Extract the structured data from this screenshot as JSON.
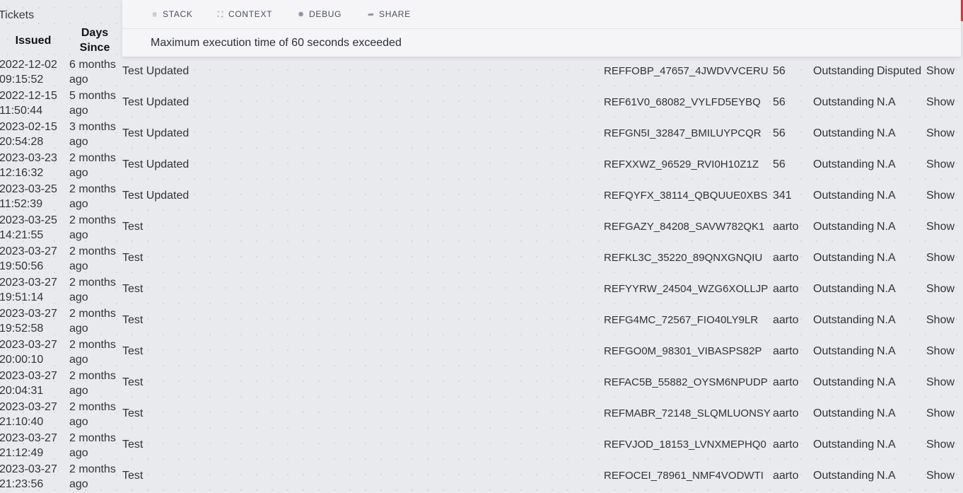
{
  "page": {
    "title": "Tickets"
  },
  "table": {
    "headers": {
      "issued": "Issued",
      "days_since_line1": "Days",
      "days_since_line2": "Since"
    },
    "rows": [
      {
        "issued_date": "2022-12-02",
        "issued_time": "09:15:52",
        "since_1": "6 months",
        "since_2": "ago",
        "title": "Test Updated",
        "reference": "REFFOBP_47657_4JWDVVCERU",
        "amount": "56",
        "status": "Outstanding",
        "dispute": "Disputed",
        "action": "Show"
      },
      {
        "issued_date": "2022-12-15",
        "issued_time": "11:50:44",
        "since_1": "5 months",
        "since_2": "ago",
        "title": "Test Updated",
        "reference": "REF61V0_68082_VYLFD5EYBQ",
        "amount": "56",
        "status": "Outstanding",
        "dispute": "N.A",
        "action": "Show"
      },
      {
        "issued_date": "2023-02-15",
        "issued_time": "20:54:28",
        "since_1": "3 months",
        "since_2": "ago",
        "title": "Test Updated",
        "reference": "REFGN5I_32847_BMILUYPCQR",
        "amount": "56",
        "status": "Outstanding",
        "dispute": "N.A",
        "action": "Show"
      },
      {
        "issued_date": "2023-03-23",
        "issued_time": "12:16:32",
        "since_1": "2 months",
        "since_2": "ago",
        "title": "Test Updated",
        "reference": "REFXXWZ_96529_RVI0H10Z1Z",
        "amount": "56",
        "status": "Outstanding",
        "dispute": "N.A",
        "action": "Show"
      },
      {
        "issued_date": "2023-03-25",
        "issued_time": "11:52:39",
        "since_1": "2 months",
        "since_2": "ago",
        "title": "Test Updated",
        "reference": "REFQYFX_38114_QBQUUE0XBS",
        "amount": "341",
        "status": "Outstanding",
        "dispute": "N.A",
        "action": "Show"
      },
      {
        "issued_date": "2023-03-25",
        "issued_time": "14:21:55",
        "since_1": "2 months",
        "since_2": "ago",
        "title": "Test",
        "reference": "REFGAZY_84208_SAVW782QK1",
        "amount": "aarto",
        "status": "Outstanding",
        "dispute": "N.A",
        "action": "Show"
      },
      {
        "issued_date": "2023-03-27",
        "issued_time": "19:50:56",
        "since_1": "2 months",
        "since_2": "ago",
        "title": "Test",
        "reference": "REFKL3C_35220_89QNXGNQIU",
        "amount": "aarto",
        "status": "Outstanding",
        "dispute": "N.A",
        "action": "Show"
      },
      {
        "issued_date": "2023-03-27",
        "issued_time": "19:51:14",
        "since_1": "2 months",
        "since_2": "ago",
        "title": "Test",
        "reference": "REFYYRW_24504_WZG6XOLLJP",
        "amount": "aarto",
        "status": "Outstanding",
        "dispute": "N.A",
        "action": "Show"
      },
      {
        "issued_date": "2023-03-27",
        "issued_time": "19:52:58",
        "since_1": "2 months",
        "since_2": "ago",
        "title": "Test",
        "reference": "REFG4MC_72567_FIO40LY9LR",
        "amount": "aarto",
        "status": "Outstanding",
        "dispute": "N.A",
        "action": "Show"
      },
      {
        "issued_date": "2023-03-27",
        "issued_time": "20:00:10",
        "since_1": "2 months",
        "since_2": "ago",
        "title": "Test",
        "reference": "REFGO0M_98301_VIBASPS82P",
        "amount": "aarto",
        "status": "Outstanding",
        "dispute": "N.A",
        "action": "Show"
      },
      {
        "issued_date": "2023-03-27",
        "issued_time": "20:04:31",
        "since_1": "2 months",
        "since_2": "ago",
        "title": "Test",
        "reference": "REFAC5B_55882_OYSM6NPUDP",
        "amount": "aarto",
        "status": "Outstanding",
        "dispute": "N.A",
        "action": "Show"
      },
      {
        "issued_date": "2023-03-27",
        "issued_time": "21:10:40",
        "since_1": "2 months",
        "since_2": "ago",
        "title": "Test",
        "reference": "REFMABR_72148_SLQMLUONSY",
        "amount": "aarto",
        "status": "Outstanding",
        "dispute": "N.A",
        "action": "Show"
      },
      {
        "issued_date": "2023-03-27",
        "issued_time": "21:12:49",
        "since_1": "2 months",
        "since_2": "ago",
        "title": "Test",
        "reference": "REFVJOD_18153_LVNXMEPHQ0",
        "amount": "aarto",
        "status": "Outstanding",
        "dispute": "N.A",
        "action": "Show"
      },
      {
        "issued_date": "2023-03-27",
        "issued_time": "21:23:56",
        "since_1": "2 months",
        "since_2": "ago",
        "title": "Test",
        "reference": "REFOCEI_78961_NMF4VODWTI",
        "amount": "aarto",
        "status": "Outstanding",
        "dispute": "N.A",
        "action": "Show"
      }
    ]
  },
  "error_panel": {
    "tabs": [
      {
        "label": "STACK",
        "icon": "stack-icon"
      },
      {
        "label": "CONTEXT",
        "icon": "context-icon"
      },
      {
        "label": "DEBUG",
        "icon": "bug-icon"
      },
      {
        "label": "SHARE",
        "icon": "share-icon"
      }
    ],
    "message": "Maximum execution time of 60 seconds exceeded",
    "accent_color": "#e0333a"
  }
}
